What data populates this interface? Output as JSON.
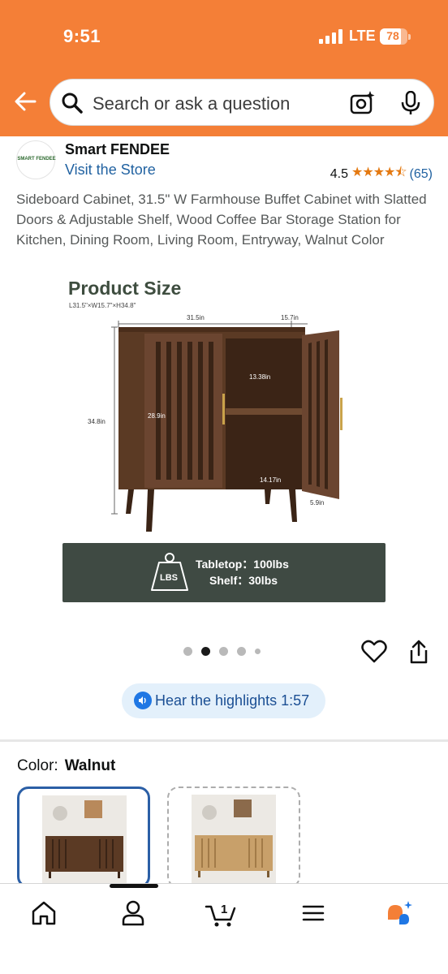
{
  "status_bar": {
    "time": "9:51",
    "network": "LTE",
    "battery": "78"
  },
  "search": {
    "placeholder": "Search or ask a question"
  },
  "brand": {
    "logo_text": "SMART FENDEE",
    "name": "Smart FENDEE",
    "visit_store": "Visit the Store"
  },
  "rating": {
    "value": "4.5",
    "stars_value": 4.5,
    "count": "(65)"
  },
  "product": {
    "title": "Sideboard Cabinet, 31.5\" W Farmhouse Buffet Cabinet with Slatted Doors & Adjustable Shelf, Wood Coffee Bar Storage Station for Kitchen, Dining Room, Living Room, Entryway, Walnut Color"
  },
  "image": {
    "heading": "Product Size",
    "subheading": "L31.5\"×W15.7\"×H34.8\"",
    "dims": {
      "width": "31.5in",
      "depth": "15.7in",
      "height": "34.8in",
      "door_height": "28.9in",
      "shelf_gap": "13.38in",
      "inner_depth": "14.17in",
      "leg": "5.9in"
    },
    "load_badge": "LBS",
    "tabletop": "Tabletop：100lbs",
    "shelf": "Shelf：30lbs"
  },
  "carousel": {
    "total": 5,
    "active_index": 1
  },
  "hear_highlights": "Hear the highlights 1:57",
  "color": {
    "label": "Color:",
    "selected": "Walnut"
  },
  "nav": {
    "cart_count": "1"
  },
  "colors": {
    "header": "#f47f37",
    "link": "#2162a1",
    "star": "#e47911",
    "walnut": "#5b3a24",
    "oak": "#c8a06a"
  }
}
